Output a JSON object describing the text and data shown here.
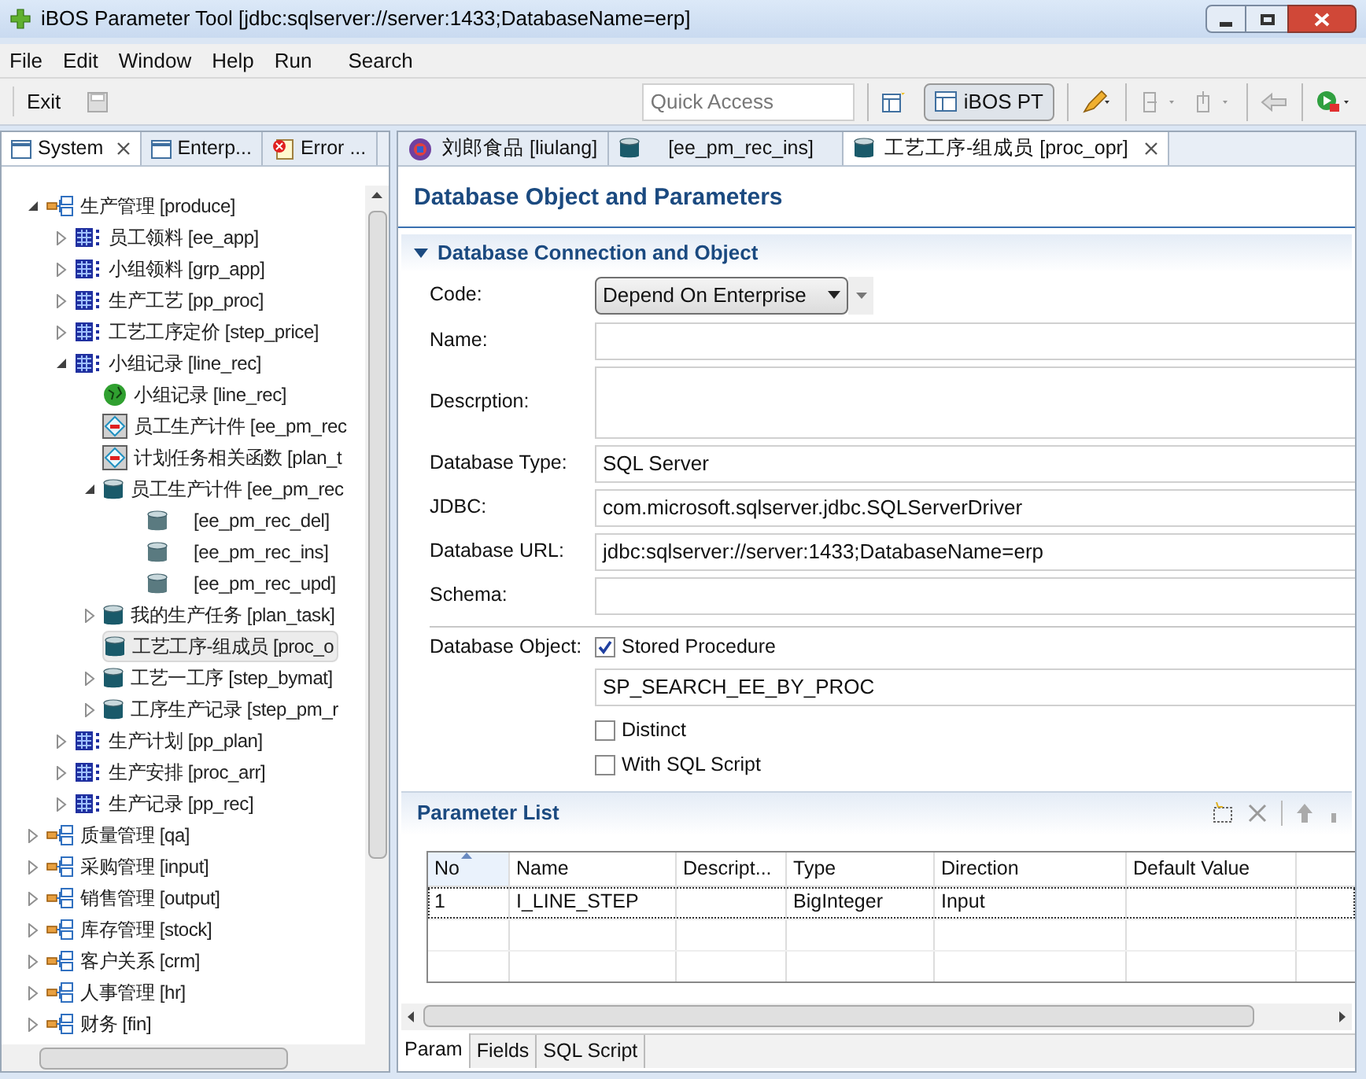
{
  "window": {
    "title": "iBOS Parameter Tool [jdbc:sqlserver://server:1433;DatabaseName=erp]"
  },
  "menu": [
    "File",
    "Edit",
    "Window",
    "Help",
    "Run",
    "Search"
  ],
  "toolbar": {
    "exit": "Exit",
    "quick_access": {
      "placeholder": "Quick Access"
    },
    "perspective": "iBOS PT"
  },
  "left_tabs": [
    {
      "label": "System",
      "selected": true
    },
    {
      "label": "Enterp...",
      "selected": false
    },
    {
      "label": "Error ...",
      "selected": false
    }
  ],
  "tree": [
    {
      "label": "生产管理 [produce]",
      "kind": "module",
      "has_children": true,
      "expanded": true,
      "selected": false,
      "children": [
        {
          "label": "员工领料 [ee_app]",
          "kind": "table",
          "has_children": true,
          "expanded": false,
          "selected": false
        },
        {
          "label": "小组领料 [grp_app]",
          "kind": "table",
          "has_children": true,
          "expanded": false,
          "selected": false
        },
        {
          "label": "生产工艺 [pp_proc]",
          "kind": "table",
          "has_children": true,
          "expanded": false,
          "selected": false
        },
        {
          "label": "工艺工序定价 [step_price]",
          "kind": "table",
          "has_children": true,
          "expanded": false,
          "selected": false
        },
        {
          "label": "小组记录 [line_rec]",
          "kind": "table",
          "has_children": true,
          "expanded": true,
          "selected": false,
          "children": [
            {
              "label": "小组记录 [line_rec]",
              "kind": "view",
              "has_children": false,
              "selected": false
            },
            {
              "label": "员工生产计件 [ee_pm_rec",
              "kind": "function",
              "has_children": false,
              "selected": false
            },
            {
              "label": "计划任务相关函数 [plan_t",
              "kind": "function",
              "has_children": false,
              "selected": false
            },
            {
              "label": "员工生产计件 [ee_pm_rec",
              "kind": "proc",
              "has_children": true,
              "expanded": true,
              "selected": false,
              "children": [
                {
                  "label": "[ee_pm_rec_del]",
                  "kind": "proc_small",
                  "has_children": false,
                  "selected": false
                },
                {
                  "label": "[ee_pm_rec_ins]",
                  "kind": "proc_small",
                  "has_children": false,
                  "selected": false
                },
                {
                  "label": "[ee_pm_rec_upd]",
                  "kind": "proc_small",
                  "has_children": false,
                  "selected": false
                }
              ]
            },
            {
              "label": "我的生产任务 [plan_task]",
              "kind": "proc",
              "has_children": true,
              "expanded": false,
              "selected": false
            },
            {
              "label": "工艺工序-组成员 [proc_o",
              "kind": "proc",
              "has_children": false,
              "selected": true
            },
            {
              "label": "工艺一工序 [step_bymat]",
              "kind": "proc",
              "has_children": true,
              "expanded": false,
              "selected": false
            },
            {
              "label": "工序生产记录 [step_pm_r",
              "kind": "proc",
              "has_children": true,
              "expanded": false,
              "selected": false
            }
          ]
        },
        {
          "label": "生产计划 [pp_plan]",
          "kind": "table",
          "has_children": true,
          "expanded": false,
          "selected": false
        },
        {
          "label": "生产安排 [proc_arr]",
          "kind": "table",
          "has_children": true,
          "expanded": false,
          "selected": false
        },
        {
          "label": "生产记录 [pp_rec]",
          "kind": "table",
          "has_children": true,
          "expanded": false,
          "selected": false
        }
      ]
    },
    {
      "label": "质量管理 [qa]",
      "kind": "module",
      "has_children": true,
      "expanded": false,
      "selected": false
    },
    {
      "label": "采购管理 [input]",
      "kind": "module",
      "has_children": true,
      "expanded": false,
      "selected": false
    },
    {
      "label": "销售管理 [output]",
      "kind": "module",
      "has_children": true,
      "expanded": false,
      "selected": false
    },
    {
      "label": "库存管理 [stock]",
      "kind": "module",
      "has_children": true,
      "expanded": false,
      "selected": false
    },
    {
      "label": "客户关系 [crm]",
      "kind": "module",
      "has_children": true,
      "expanded": false,
      "selected": false
    },
    {
      "label": "人事管理 [hr]",
      "kind": "module",
      "has_children": true,
      "expanded": false,
      "selected": false
    },
    {
      "label": "财务 [fin]",
      "kind": "module",
      "has_children": true,
      "expanded": false,
      "selected": false
    }
  ],
  "editor_tabs": [
    {
      "label": "刘郎食品 [liulang]",
      "kind": "enterprise",
      "selected": false
    },
    {
      "label": "[ee_pm_rec_ins]",
      "kind": "proc",
      "selected": false
    },
    {
      "label": "工艺工序-组成员 [proc_opr]",
      "kind": "proc",
      "selected": true
    }
  ],
  "form": {
    "title": "Database Object and Parameters",
    "section": {
      "title": "Database Connection and Object",
      "expanded": true
    },
    "code": {
      "label": "Code:",
      "value": "Depend On Enterprise"
    },
    "fields": [
      {
        "label": "Name:",
        "kind": "line"
      },
      {
        "label": "Descrption:",
        "kind": "area"
      },
      {
        "label": "Database Type:",
        "kind": "line",
        "value": "SQL Server"
      },
      {
        "label": "JDBC:",
        "kind": "line",
        "value": "com.microsoft.sqlserver.jdbc.SQLServerDriver"
      },
      {
        "label": "Database URL:",
        "kind": "line",
        "value": "jdbc:sqlserver://server:1433;DatabaseName=erp"
      },
      {
        "label": "Schema:",
        "kind": "line"
      }
    ],
    "database_object": {
      "label": "Database Object:",
      "stored_procedure": {
        "label": "Stored Procedure",
        "checked": true
      },
      "object_name": "SP_SEARCH_EE_BY_PROC",
      "distinct": {
        "label": "Distinct",
        "checked": false
      },
      "with_sql_script": {
        "label": "With SQL Script",
        "checked": false
      }
    }
  },
  "parameter_list": {
    "title": "Parameter List",
    "columns": [
      {
        "label": "No",
        "sorted": true
      },
      {
        "label": "Name",
        "sorted": false
      },
      {
        "label": "Descript...",
        "sorted": false
      },
      {
        "label": "Type",
        "sorted": false
      },
      {
        "label": "Direction",
        "sorted": false
      },
      {
        "label": "Default Value",
        "sorted": false
      }
    ],
    "rows": [
      {
        "no": "1",
        "name": "I_LINE_STEP",
        "type": "BigInteger",
        "direction": "Input",
        "selected": true
      }
    ]
  },
  "bottom_tabs": [
    {
      "label": "Param",
      "selected": true
    },
    {
      "label": "Fields",
      "selected": false
    },
    {
      "label": "SQL Script",
      "selected": false
    }
  ]
}
